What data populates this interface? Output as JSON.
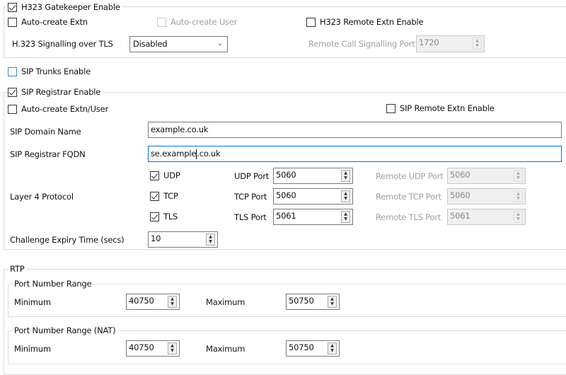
{
  "h323": {
    "gatekeeper_enable": {
      "label": "H323 Gatekeeper Enable",
      "checked": true
    },
    "auto_create_extn": {
      "label": "Auto-create Extn",
      "checked": false
    },
    "auto_create_user": {
      "label": "Auto-create User",
      "checked": false,
      "disabled": true
    },
    "remote_extn_enable": {
      "label": "H323 Remote Extn Enable",
      "checked": false
    },
    "signalling_tls": {
      "label": "H.323 Signalling over TLS",
      "value": "Disabled"
    },
    "remote_call_port": {
      "label": "Remote Call Signalling Port",
      "value": "1720",
      "disabled": true
    }
  },
  "sip_trunks": {
    "label": "SIP Trunks Enable",
    "checked": false
  },
  "sip_registrar": {
    "enable": {
      "label": "SIP Registrar Enable",
      "checked": true
    },
    "auto_create": {
      "label": "Auto-create Extn/User",
      "checked": false
    },
    "remote_extn_enable": {
      "label": "SIP Remote Extn Enable",
      "checked": false
    },
    "domain_name": {
      "label": "SIP Domain Name",
      "value": "example.co.uk"
    },
    "fqdn": {
      "label": "SIP Registrar FQDN",
      "value_before_caret": "se.example",
      "value_after_caret": ".co.uk"
    },
    "layer4_label": "Layer 4 Protocol",
    "protocols": [
      {
        "label": "UDP",
        "checked": true,
        "port_label": "UDP Port",
        "port": "5060",
        "remote_label": "Remote UDP Port",
        "remote_port": "5060"
      },
      {
        "label": "TCP",
        "checked": true,
        "port_label": "TCP Port",
        "port": "5060",
        "remote_label": "Remote TCP Port",
        "remote_port": "5060"
      },
      {
        "label": "TLS",
        "checked": true,
        "port_label": "TLS Port",
        "port": "5061",
        "remote_label": "Remote TLS Port",
        "remote_port": "5061"
      }
    ],
    "challenge_expiry": {
      "label": "Challenge Expiry Time (secs)",
      "value": "10"
    }
  },
  "rtp": {
    "title": "RTP",
    "ranges": [
      {
        "title": "Port Number Range",
        "min_label": "Minimum",
        "min": "40750",
        "max_label": "Maximum",
        "max": "50750"
      },
      {
        "title": "Port Number Range (NAT)",
        "min_label": "Minimum",
        "min": "40750",
        "max_label": "Maximum",
        "max": "50750"
      }
    ]
  },
  "colors": {
    "focus": "#0078d7",
    "group_border": "#dcdcdc",
    "disabled_text": "#a0a0a0"
  }
}
